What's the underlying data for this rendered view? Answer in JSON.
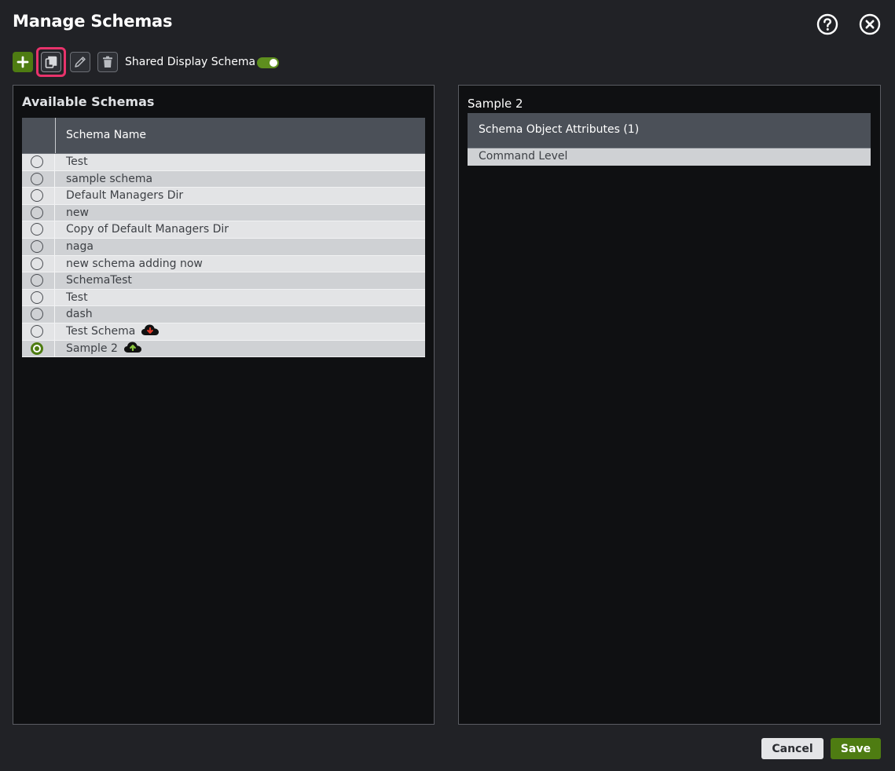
{
  "dialog": {
    "title": "Manage Schemas"
  },
  "header_icons": [
    "help-icon",
    "close-icon"
  ],
  "toolbar": {
    "shared_label": "Shared Display Schema",
    "shared_enabled": true,
    "buttons": [
      "add-icon",
      "copy-icon",
      "edit-icon",
      "trash-icon"
    ]
  },
  "available": {
    "title": "Available Schemas",
    "column": "Schema Name",
    "rows": [
      {
        "name": "Test",
        "selected": false
      },
      {
        "name": "sample schema",
        "selected": false
      },
      {
        "name": "Default Managers Dir",
        "selected": false
      },
      {
        "name": "new",
        "selected": false
      },
      {
        "name": "Copy of Default Managers Dir",
        "selected": false
      },
      {
        "name": "naga",
        "selected": false
      },
      {
        "name": "new schema adding now",
        "selected": false
      },
      {
        "name": "SchemaTest",
        "selected": false
      },
      {
        "name": "Test",
        "selected": false
      },
      {
        "name": "dash",
        "selected": false
      },
      {
        "name": "Test Schema",
        "selected": false,
        "icon": "cloud-download-icon"
      },
      {
        "name": "Sample 2",
        "selected": true,
        "icon": "cloud-upload-icon"
      }
    ]
  },
  "detail": {
    "title": "Sample 2",
    "header": "Schema Object Attributes (1)",
    "attributes": [
      "Command Level"
    ]
  },
  "footer": {
    "cancel": "Cancel",
    "save": "Save"
  },
  "colors": {
    "accent": "#4e7c12",
    "highlight": "#e8336b",
    "download": "#e03a2a",
    "upload": "#8ac53e"
  }
}
